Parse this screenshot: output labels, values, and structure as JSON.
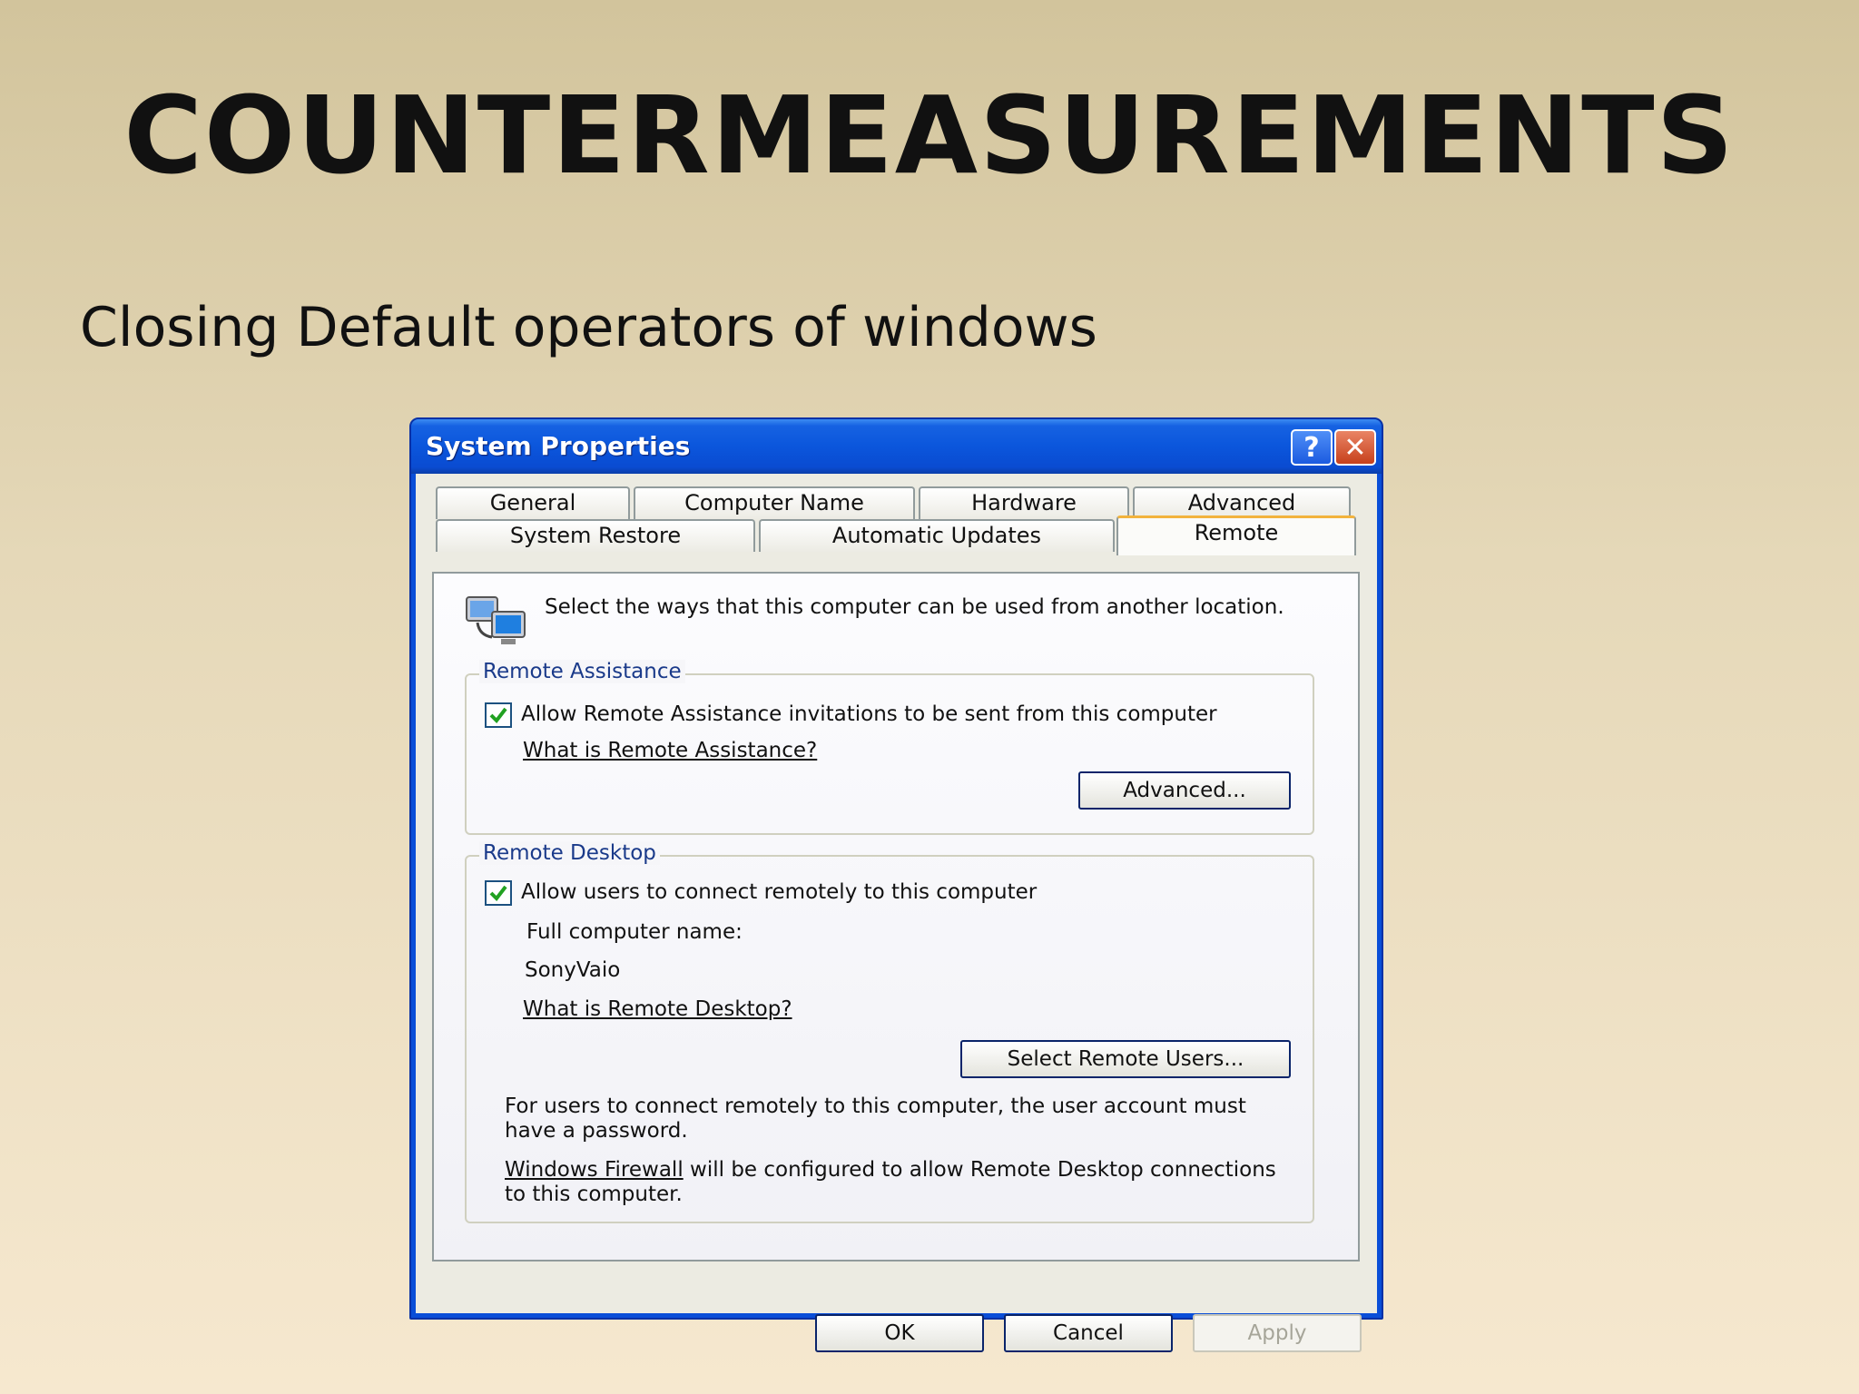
{
  "slide": {
    "title": "COUNTERMEASUREMENTS",
    "subtitle": "Closing Default operators of windows"
  },
  "window": {
    "title": "System Properties",
    "help_glyph": "?",
    "close_glyph": "✕"
  },
  "tabs": {
    "row1": [
      "General",
      "Computer Name",
      "Hardware",
      "Advanced"
    ],
    "row2": [
      "System Restore",
      "Automatic Updates"
    ],
    "active": "Remote"
  },
  "panel": {
    "intro": "Select the ways that this computer can be used from another location.",
    "remote_assistance": {
      "label": "Remote Assistance",
      "checkbox_label": "Allow Remote Assistance invitations to be sent from this computer",
      "checked": true,
      "help_link": "What is Remote Assistance?",
      "advanced_button": "Advanced..."
    },
    "remote_desktop": {
      "label": "Remote Desktop",
      "checkbox_label": "Allow users to connect remotely to this computer",
      "checked": true,
      "computer_name_label": "Full computer name:",
      "computer_name": "SonyVaio",
      "help_link": "What is Remote Desktop?",
      "select_users_button": "Select Remote Users...",
      "password_note": "For users to connect remotely to this computer, the user account must have a password.",
      "firewall_link": "Windows Firewall",
      "firewall_note": " will be configured to allow Remote Desktop connections to this computer."
    }
  },
  "footer": {
    "ok": "OK",
    "cancel": "Cancel",
    "apply": "Apply"
  },
  "colors": {
    "titlebar": "#0b56dc",
    "tab_highlight": "#f2b33d",
    "check": "#21a121"
  }
}
